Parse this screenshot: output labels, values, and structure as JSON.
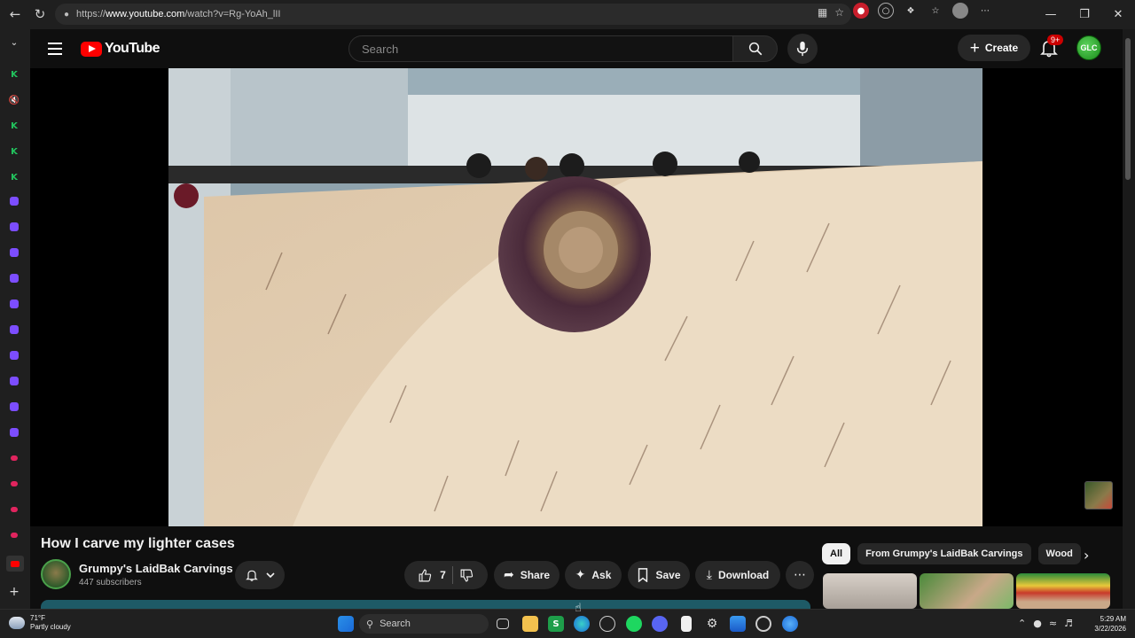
{
  "browser": {
    "url_prefix": "https://",
    "url_host": "www.youtube.com",
    "url_path": "/watch?v=Rg-YoAh_lII"
  },
  "youtube": {
    "logo_text": "YouTube",
    "search_placeholder": "Search",
    "create_label": "Create",
    "notification_count": "9+"
  },
  "video": {
    "title": "How I carve my lighter cases",
    "channel_name": "Grumpy's LaidBak Carvings",
    "subscribers": "447 subscribers",
    "like_count": "7",
    "share_label": "Share",
    "ask_label": "Ask",
    "save_label": "Save",
    "download_label": "Download"
  },
  "recommendations": {
    "chips": [
      "All",
      "From Grumpy's LaidBak Carvings",
      "Wood"
    ]
  },
  "taskbar": {
    "temperature": "71°F",
    "weather_desc": "Partly cloudy",
    "search_label": "Search",
    "time": "5:29 AM",
    "date": "3/22/2026"
  },
  "colors": {
    "yt_red": "#ff0000",
    "background": "#0f0f0f",
    "pill_bg": "#272727"
  }
}
